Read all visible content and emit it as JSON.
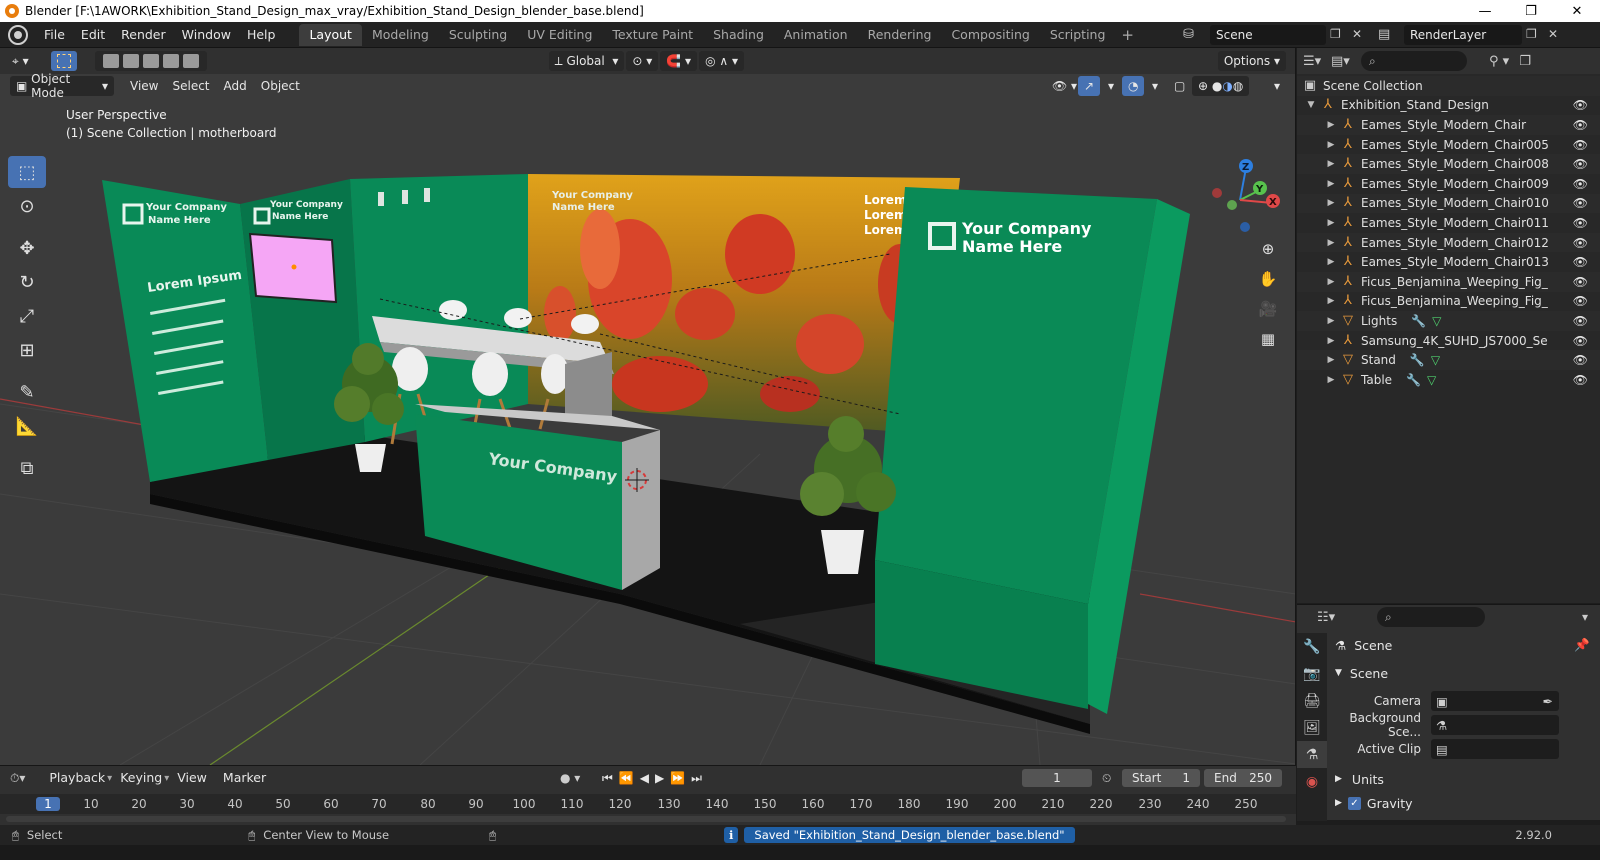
{
  "window": {
    "title": "Blender [F:\\1AWORK\\Exhibition_Stand_Design_max_vray/Exhibition_Stand_Design_blender_base.blend]",
    "controls": [
      "—",
      "❐",
      "✕"
    ]
  },
  "menu": [
    "File",
    "Edit",
    "Render",
    "Window",
    "Help"
  ],
  "workspaces": [
    "Layout",
    "Modeling",
    "Sculpting",
    "UV Editing",
    "Texture Paint",
    "Shading",
    "Animation",
    "Rendering",
    "Compositing",
    "Scripting"
  ],
  "active_workspace": "Layout",
  "scene_name": "Scene",
  "view_layer": "RenderLayer",
  "viewport": {
    "transform_orientation": "Global",
    "options_label": "Options",
    "mode": "Object Mode",
    "menus": [
      "View",
      "Select",
      "Add",
      "Object"
    ],
    "info_line1": "User Perspective",
    "info_line2": "(1) Scene Collection | motherboard",
    "axis_labels": {
      "z": "Z",
      "y": "Y",
      "x": "X"
    },
    "stand": {
      "wall_logo_left": [
        "Your Company",
        "Name Here"
      ],
      "wall_logo_mid": [
        "Your Company",
        "Name Here"
      ],
      "wall_heading": "Lorem Ipsum",
      "photo_logo": [
        "Your Company",
        "Name Here"
      ],
      "photo_lorem": [
        "Lorem",
        "Lorem",
        "Lorem"
      ],
      "right_logo": [
        "Your Company",
        "Name Here"
      ],
      "counter_text": "Your Company"
    }
  },
  "outliner": {
    "root": "Scene Collection",
    "collection": "Exhibition_Stand_Design",
    "items": [
      {
        "name": "Eames_Style_Modern_Chair",
        "type": "empty"
      },
      {
        "name": "Eames_Style_Modern_Chair005",
        "type": "empty"
      },
      {
        "name": "Eames_Style_Modern_Chair008",
        "type": "empty"
      },
      {
        "name": "Eames_Style_Modern_Chair009",
        "type": "empty"
      },
      {
        "name": "Eames_Style_Modern_Chair010",
        "type": "empty"
      },
      {
        "name": "Eames_Style_Modern_Chair011",
        "type": "empty"
      },
      {
        "name": "Eames_Style_Modern_Chair012",
        "type": "empty"
      },
      {
        "name": "Eames_Style_Modern_Chair013",
        "type": "empty"
      },
      {
        "name": "Ficus_Benjamina_Weeping_Fig_",
        "type": "empty"
      },
      {
        "name": "Ficus_Benjamina_Weeping_Fig_",
        "type": "empty"
      },
      {
        "name": "Lights",
        "type": "mesh"
      },
      {
        "name": "Samsung_4K_SUHD_JS7000_Se",
        "type": "empty"
      },
      {
        "name": "Stand",
        "type": "mesh"
      },
      {
        "name": "Table",
        "type": "mesh"
      }
    ]
  },
  "properties": {
    "context": "Scene",
    "panel": "Scene",
    "camera_label": "Camera",
    "background_label": "Background Sce...",
    "active_clip_label": "Active Clip",
    "units_label": "Units",
    "gravity_label": "Gravity",
    "gravity_checked": true
  },
  "timeline": {
    "menus": [
      "Playback",
      "Keying",
      "View",
      "Marker"
    ],
    "current_frame": "1",
    "start_label": "Start",
    "start": "1",
    "end_label": "End",
    "end": "250",
    "ruler": [
      "1",
      "10",
      "20",
      "30",
      "40",
      "50",
      "60",
      "70",
      "80",
      "90",
      "100",
      "110",
      "120",
      "130",
      "140",
      "150",
      "160",
      "170",
      "180",
      "190",
      "200",
      "210",
      "220",
      "230",
      "240",
      "250"
    ]
  },
  "status": {
    "select": "Select",
    "center_view": "Center View to Mouse",
    "message": "Saved \"Exhibition_Stand_Design_blender_base.blend\"",
    "version": "2.92.0"
  },
  "colors": {
    "green": "#0a8a56",
    "green_dark": "#067045",
    "accent_blue": "#4772b3",
    "object_orange": "#e89a3c"
  }
}
